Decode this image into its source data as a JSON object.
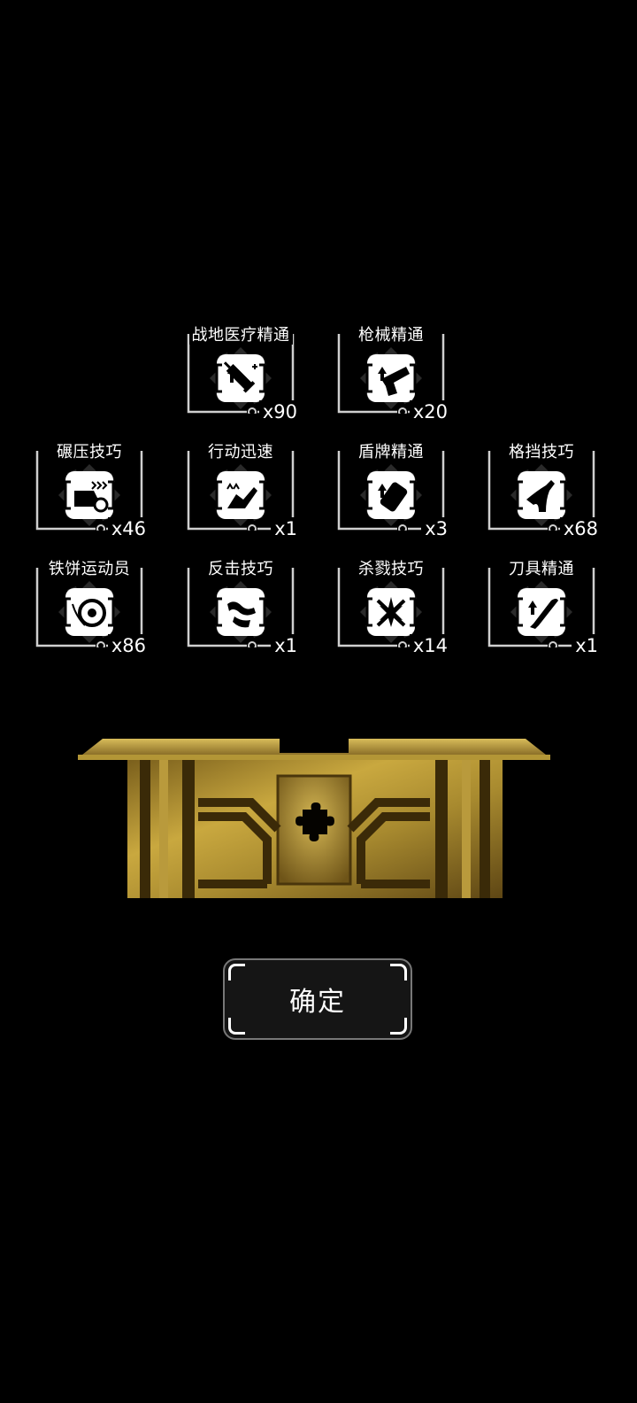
{
  "rewards": [
    {
      "label": "战地医疗精通",
      "count": "x90",
      "icon": "syringe-upgrade-icon"
    },
    {
      "label": "枪械精通",
      "count": "x20",
      "icon": "pistol-upgrade-icon"
    },
    {
      "label": "碾压技巧",
      "count": "x46",
      "icon": "crush-vehicle-icon"
    },
    {
      "label": "行动迅速",
      "count": "x1",
      "icon": "quick-move-icon"
    },
    {
      "label": "盾牌精通",
      "count": "x3",
      "icon": "shield-upgrade-icon"
    },
    {
      "label": "格挡技巧",
      "count": "x68",
      "icon": "block-arm-icon"
    },
    {
      "label": "铁饼运动员",
      "count": "x86",
      "icon": "discus-icon"
    },
    {
      "label": "反击技巧",
      "count": "x1",
      "icon": "counter-attack-icon"
    },
    {
      "label": "杀戮技巧",
      "count": "x14",
      "icon": "slaughter-icon"
    },
    {
      "label": "刀具精通",
      "count": "x1",
      "icon": "blade-upgrade-icon"
    }
  ],
  "chest": {
    "icon": "puzzle-piece-icon"
  },
  "confirm_button": {
    "label": "确定"
  },
  "colors": {
    "background": "#000000",
    "gold": "#b8972f",
    "frame": "#d9d9d9"
  }
}
